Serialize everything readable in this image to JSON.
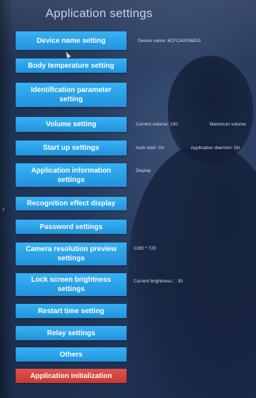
{
  "page": {
    "title": "Application settings"
  },
  "buttons": {
    "device_name": "Device name setting",
    "body_temperature": "Body temperature setting",
    "identification_parameter": "Identification parameter setting",
    "volume": "Volume setting",
    "startup": "Start up settings",
    "application_information": "Application information settings",
    "recognition_effect": "Recognition effect display",
    "password": "Password settings",
    "camera_resolution": "Camera resolution preview settings",
    "lock_screen_brightness": "Lock screen brightness settings",
    "restart_time": "Restart time setting",
    "relay": "Relay settings",
    "others": "Others",
    "application_initialization": "Application initialization"
  },
  "info": {
    "device_name": "Device name: 8CFCA0036815",
    "current_volume": "Current volume: 100",
    "maximum_volume": "Maximum volume",
    "auto_start": "Auto start: On",
    "application_daemon": "Application daemon: On",
    "display": "Display",
    "resolution": "1280 * 720",
    "current_brightness": "Current brightness： 30"
  },
  "colors": {
    "button": "#2b9ee8",
    "danger_button": "#d3463e",
    "background": "#24375a"
  },
  "icons": {
    "cursor": "mouse-pointer-icon",
    "nav": "chevron-left-icon"
  }
}
